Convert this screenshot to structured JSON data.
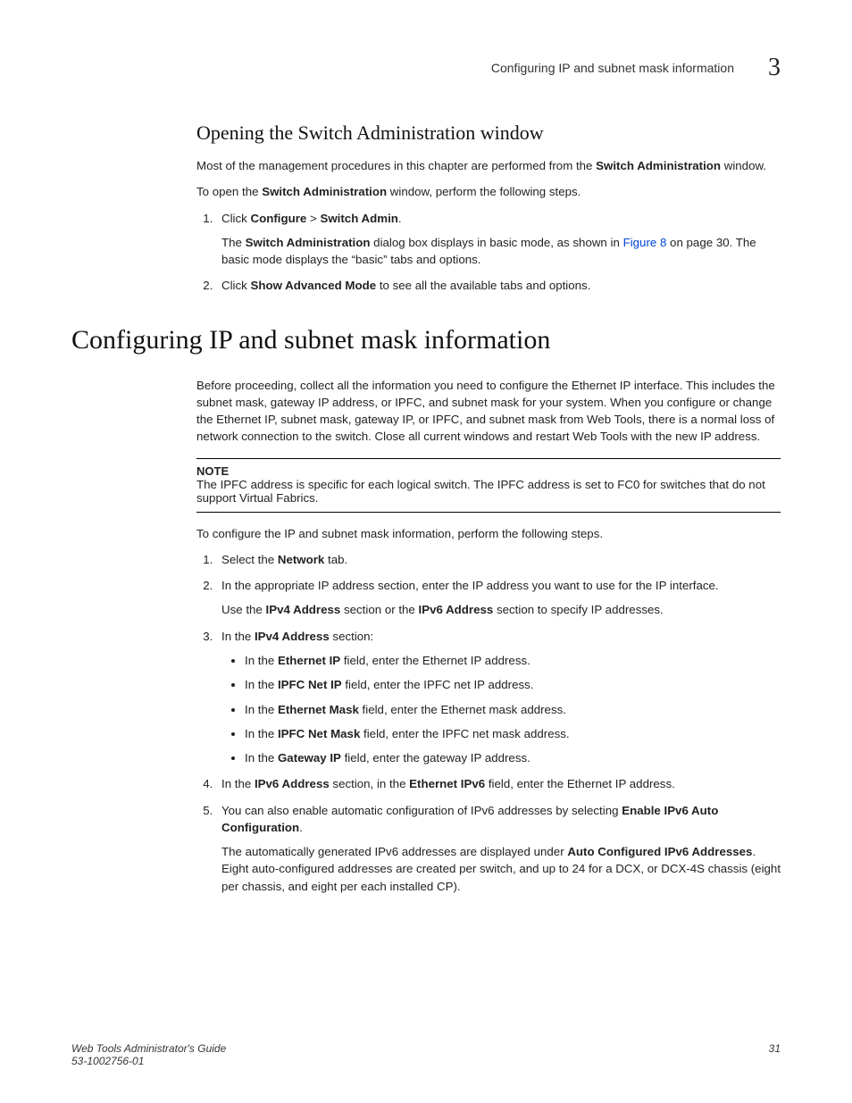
{
  "runningHead": {
    "title": "Configuring IP and subnet mask information",
    "chapterNumber": "3"
  },
  "section1": {
    "heading": "Opening the Switch Administration window",
    "para1a": "Most of the management procedures in this chapter are performed from the ",
    "para1b": "Switch Administration",
    "para1c": " window.",
    "para2a": "To open the ",
    "para2b": "Switch Administration",
    "para2c": " window, perform the following steps.",
    "steps": {
      "s1": {
        "lead": "Click ",
        "configure": "Configure",
        "gt": " > ",
        "switchAdmin": "Switch Admin",
        "tail": ".",
        "f_a": "The ",
        "f_b": "Switch Administration",
        "f_c": " dialog box displays in basic mode, as shown in ",
        "f_link": "Figure 8",
        "f_d": " on page 30. The basic mode displays the “basic” tabs and options."
      },
      "s2": {
        "lead": "Click ",
        "bold": "Show Advanced Mode",
        "tail": " to see all the available tabs and options."
      }
    }
  },
  "section2": {
    "heading": "Configuring IP and subnet mask information",
    "intro": "Before proceeding, collect all the information you need to configure the Ethernet IP interface. This includes the subnet mask, gateway IP address, or IPFC, and subnet mask for your system. When you configure or change the Ethernet IP, subnet mask, gateway IP, or IPFC, and subnet mask from Web Tools, there is a normal loss of network connection to the switch. Close all current windows and restart Web Tools with the new IP address.",
    "noteLabel": "NOTE",
    "noteBody": "The IPFC address is specific for each logical switch. The IPFC address is set to FC0 for switches that do not support Virtual Fabrics.",
    "lead": "To configure the IP and subnet mask information, perform the following steps.",
    "steps": {
      "s1": {
        "a": "Select the ",
        "b": "Network",
        "c": " tab."
      },
      "s2": {
        "line": "In the appropriate IP address section, enter the IP address you want to use for the IP interface.",
        "f_a": "Use the ",
        "f_b": "IPv4 Address",
        "f_c": " section or the ",
        "f_d": "IPv6 Address",
        "f_e": " section to specify IP addresses."
      },
      "s3": {
        "a": "In the ",
        "b": "IPv4 Address",
        "c": " section:",
        "bullets": {
          "b1": {
            "a": "In the ",
            "b": "Ethernet IP",
            "c": " field, enter the Ethernet IP address."
          },
          "b2": {
            "a": "In the ",
            "b": "IPFC Net IP",
            "c": " field, enter the IPFC net IP address."
          },
          "b3": {
            "a": "In the ",
            "b": "Ethernet Mask",
            "c": " field, enter the Ethernet mask address."
          },
          "b4": {
            "a": "In the ",
            "b": "IPFC Net Mask",
            "c": " field, enter the IPFC net mask address."
          },
          "b5": {
            "a": "In the ",
            "b": "Gateway IP",
            "c": " field, enter the gateway IP address."
          }
        }
      },
      "s4": {
        "a": "In the ",
        "b": "IPv6 Address",
        "c": " section, in the ",
        "d": "Ethernet IPv6",
        "e": " field, enter the Ethernet IP address."
      },
      "s5": {
        "a": "You can also enable automatic configuration of IPv6 addresses by selecting ",
        "b": "Enable IPv6 Auto Configuration",
        "c": ".",
        "f_a": "The automatically generated IPv6 addresses are displayed under ",
        "f_b": "Auto Configured IPv6 Addresses",
        "f_c": ". Eight auto-configured addresses are created per switch, and up to 24 for a DCX, or DCX-4S chassis (eight per chassis, and eight per each installed CP)."
      }
    }
  },
  "footer": {
    "title": "Web Tools Administrator's Guide",
    "docnum": "53-1002756-01",
    "page": "31"
  }
}
